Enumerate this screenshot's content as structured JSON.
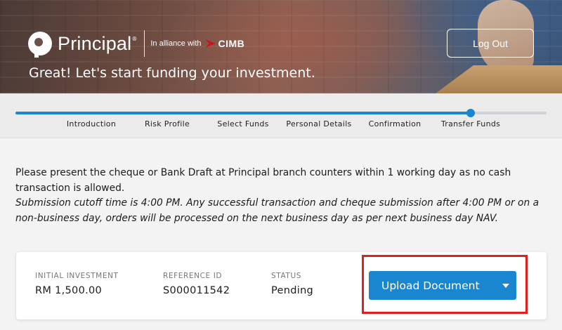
{
  "header": {
    "brand_name": "Principal",
    "brand_mark": "®",
    "alliance_text": "In alliance with",
    "partner_name": "CIMB",
    "logout_label": "Log Out",
    "headline": "Great! Let's start funding your investment."
  },
  "progress": {
    "completed_fraction": 0.857,
    "steps": [
      {
        "label": "Introduction",
        "state": "done"
      },
      {
        "label": "Risk Profile",
        "state": "done"
      },
      {
        "label": "Select Funds",
        "state": "done"
      },
      {
        "label": "Personal Details",
        "state": "done"
      },
      {
        "label": "Confirmation",
        "state": "done"
      },
      {
        "label": "Transfer Funds",
        "state": "current"
      }
    ]
  },
  "notice": {
    "main": "Please present the cheque or Bank Draft at Principal branch counters within 1 working day as no cash transaction is allowed.",
    "cutoff": "Submission cutoff time is 4:00 PM. Any successful transaction and cheque submission after 4:00 PM or on a non-business day, orders will be processed on the next business day as per next business day NAV."
  },
  "summary": {
    "initial_investment_label": "INITIAL INVESTMENT",
    "initial_investment_value": "RM 1,500.00",
    "reference_label": "REFERENCE ID",
    "reference_value": "S000011542",
    "status_label": "STATUS",
    "status_value": "Pending",
    "upload_label": "Upload Document"
  },
  "colors": {
    "accent": "#1a86d0",
    "highlight": "#e0201f",
    "partner_red": "#d3111b"
  },
  "icons": {
    "upload_caret": "chevron-down-icon",
    "partner_logo": "cimb-logo-icon",
    "brand_logo": "principal-logo-icon"
  }
}
